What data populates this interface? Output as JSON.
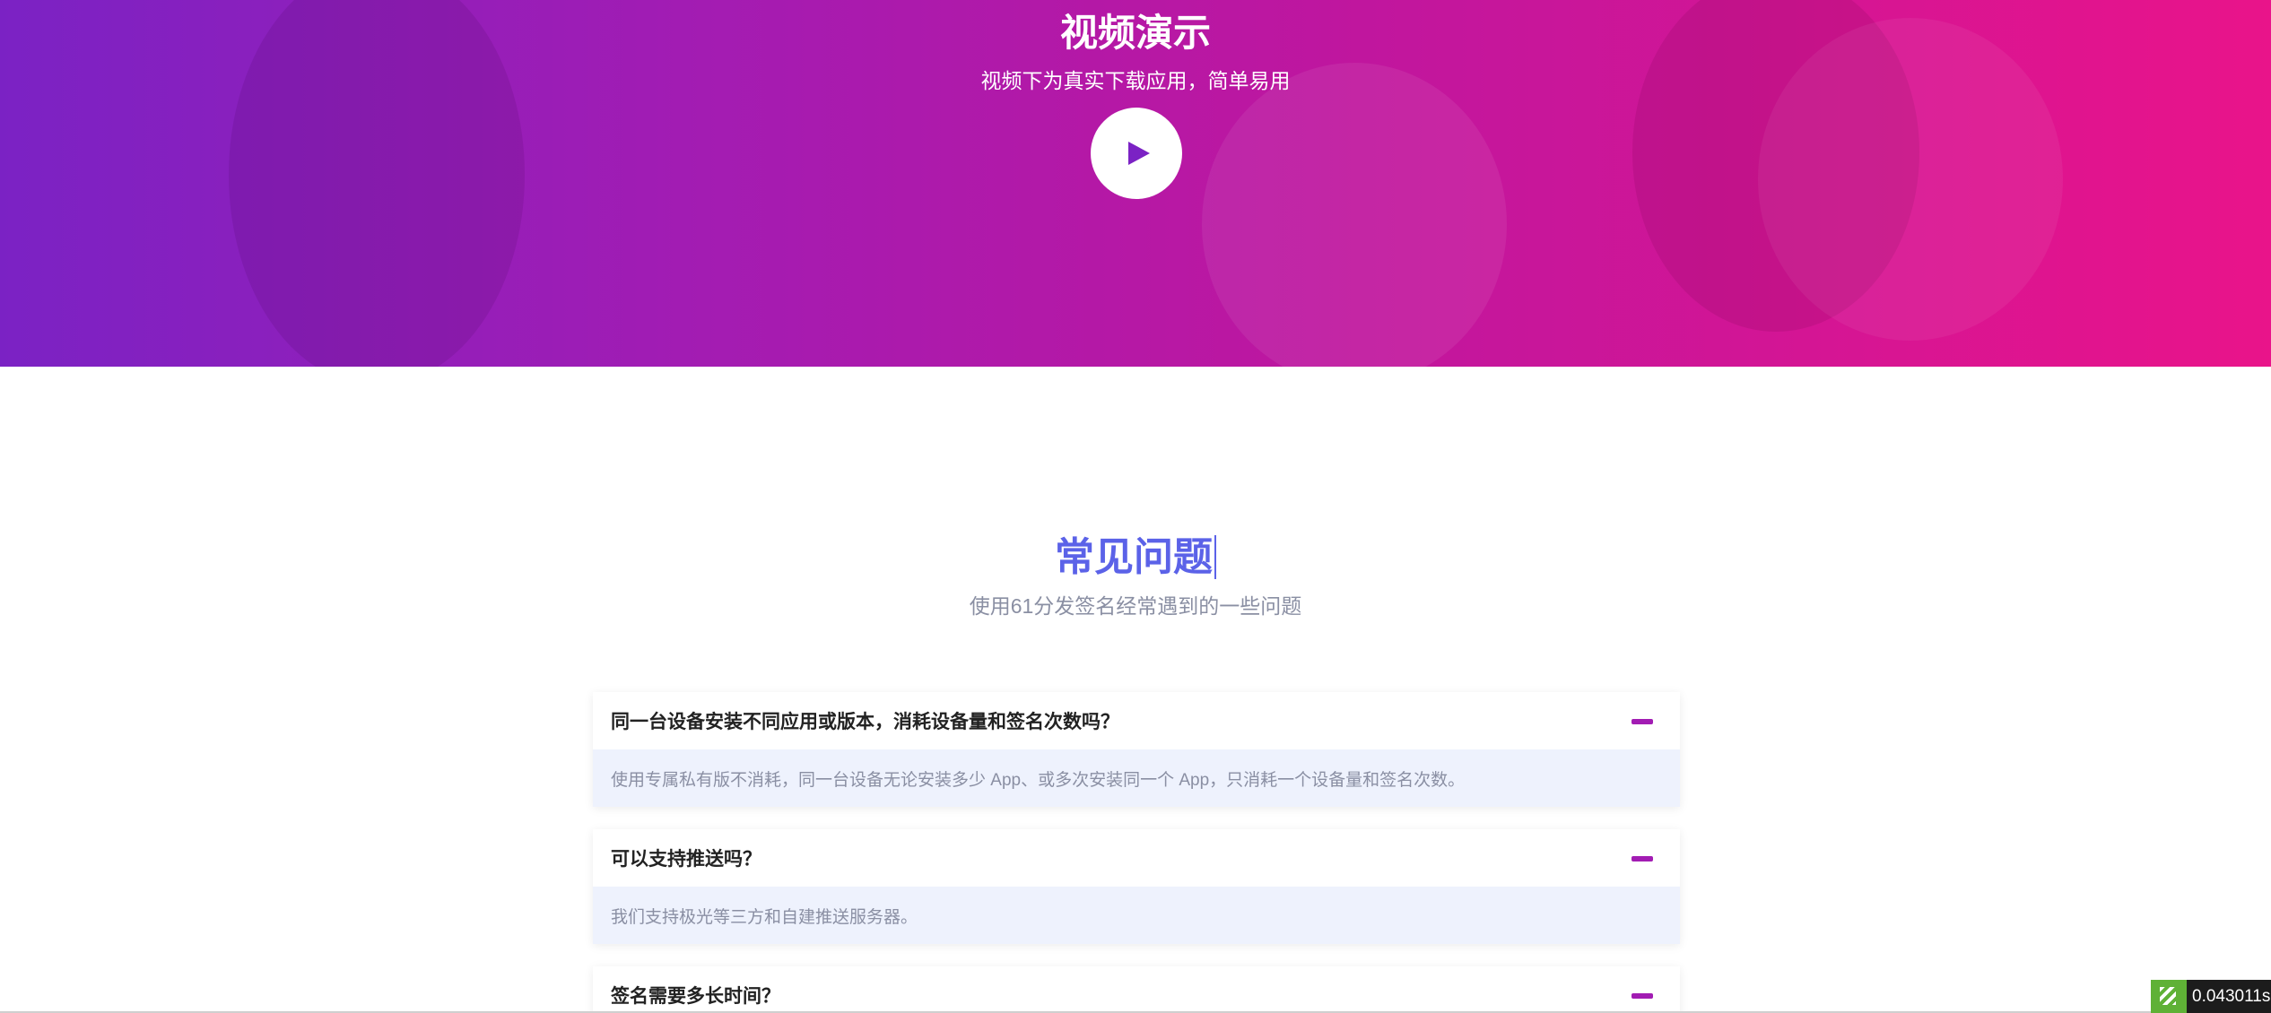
{
  "video_section": {
    "title": "视频演示",
    "subtitle": "视频下为真实下载应用，简单易用",
    "play_icon": "play-icon"
  },
  "faq": {
    "title": "常见问题",
    "subtitle": "使用61分发签名经常遇到的一些问题",
    "items": [
      {
        "question": "同一台设备安装不同应用或版本，消耗设备量和签名次数吗？",
        "answer": "使用专属私有版不消耗，同一台设备无论安装多少 App、或多次安装同一个 App，只消耗一个设备量和签名次数。",
        "toggle_icon": "minus-icon"
      },
      {
        "question": "可以支持推送吗？",
        "answer": "我们支持极光等三方和自建推送服务器。",
        "toggle_icon": "minus-icon"
      },
      {
        "question": "签名需要多长时间？",
        "toggle_icon": "minus-icon"
      }
    ]
  },
  "perf_badge": {
    "value": "0.043011s"
  },
  "colors": {
    "accent_purple": "#a21cb3",
    "faq_title": "#5b62e8",
    "answer_bg": "#eef2fd"
  }
}
